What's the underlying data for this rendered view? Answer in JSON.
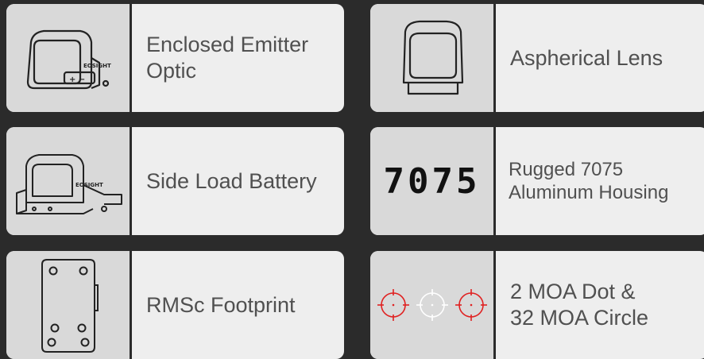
{
  "features": [
    {
      "label": "Enclosed Emitter\nOptic",
      "icon": "enclosed-optic-icon"
    },
    {
      "label": "Aspherical Lens",
      "icon": "aspherical-lens-icon"
    },
    {
      "label": "Side Load Battery",
      "icon": "side-load-battery-icon"
    },
    {
      "label": "Rugged 7075\nAluminum Housing",
      "icon": "7075-text-icon",
      "icon_text": "7075"
    },
    {
      "label": "RMSc Footprint",
      "icon": "rmsc-footprint-icon"
    },
    {
      "label": "2 MOA Dot &\n32 MOA Circle",
      "icon": "reticle-icon"
    }
  ],
  "colors": {
    "background": "#2b2b2b",
    "card": "#eeeeee",
    "thumb": "#d9d9d9",
    "reticle_red": "#e02020"
  }
}
